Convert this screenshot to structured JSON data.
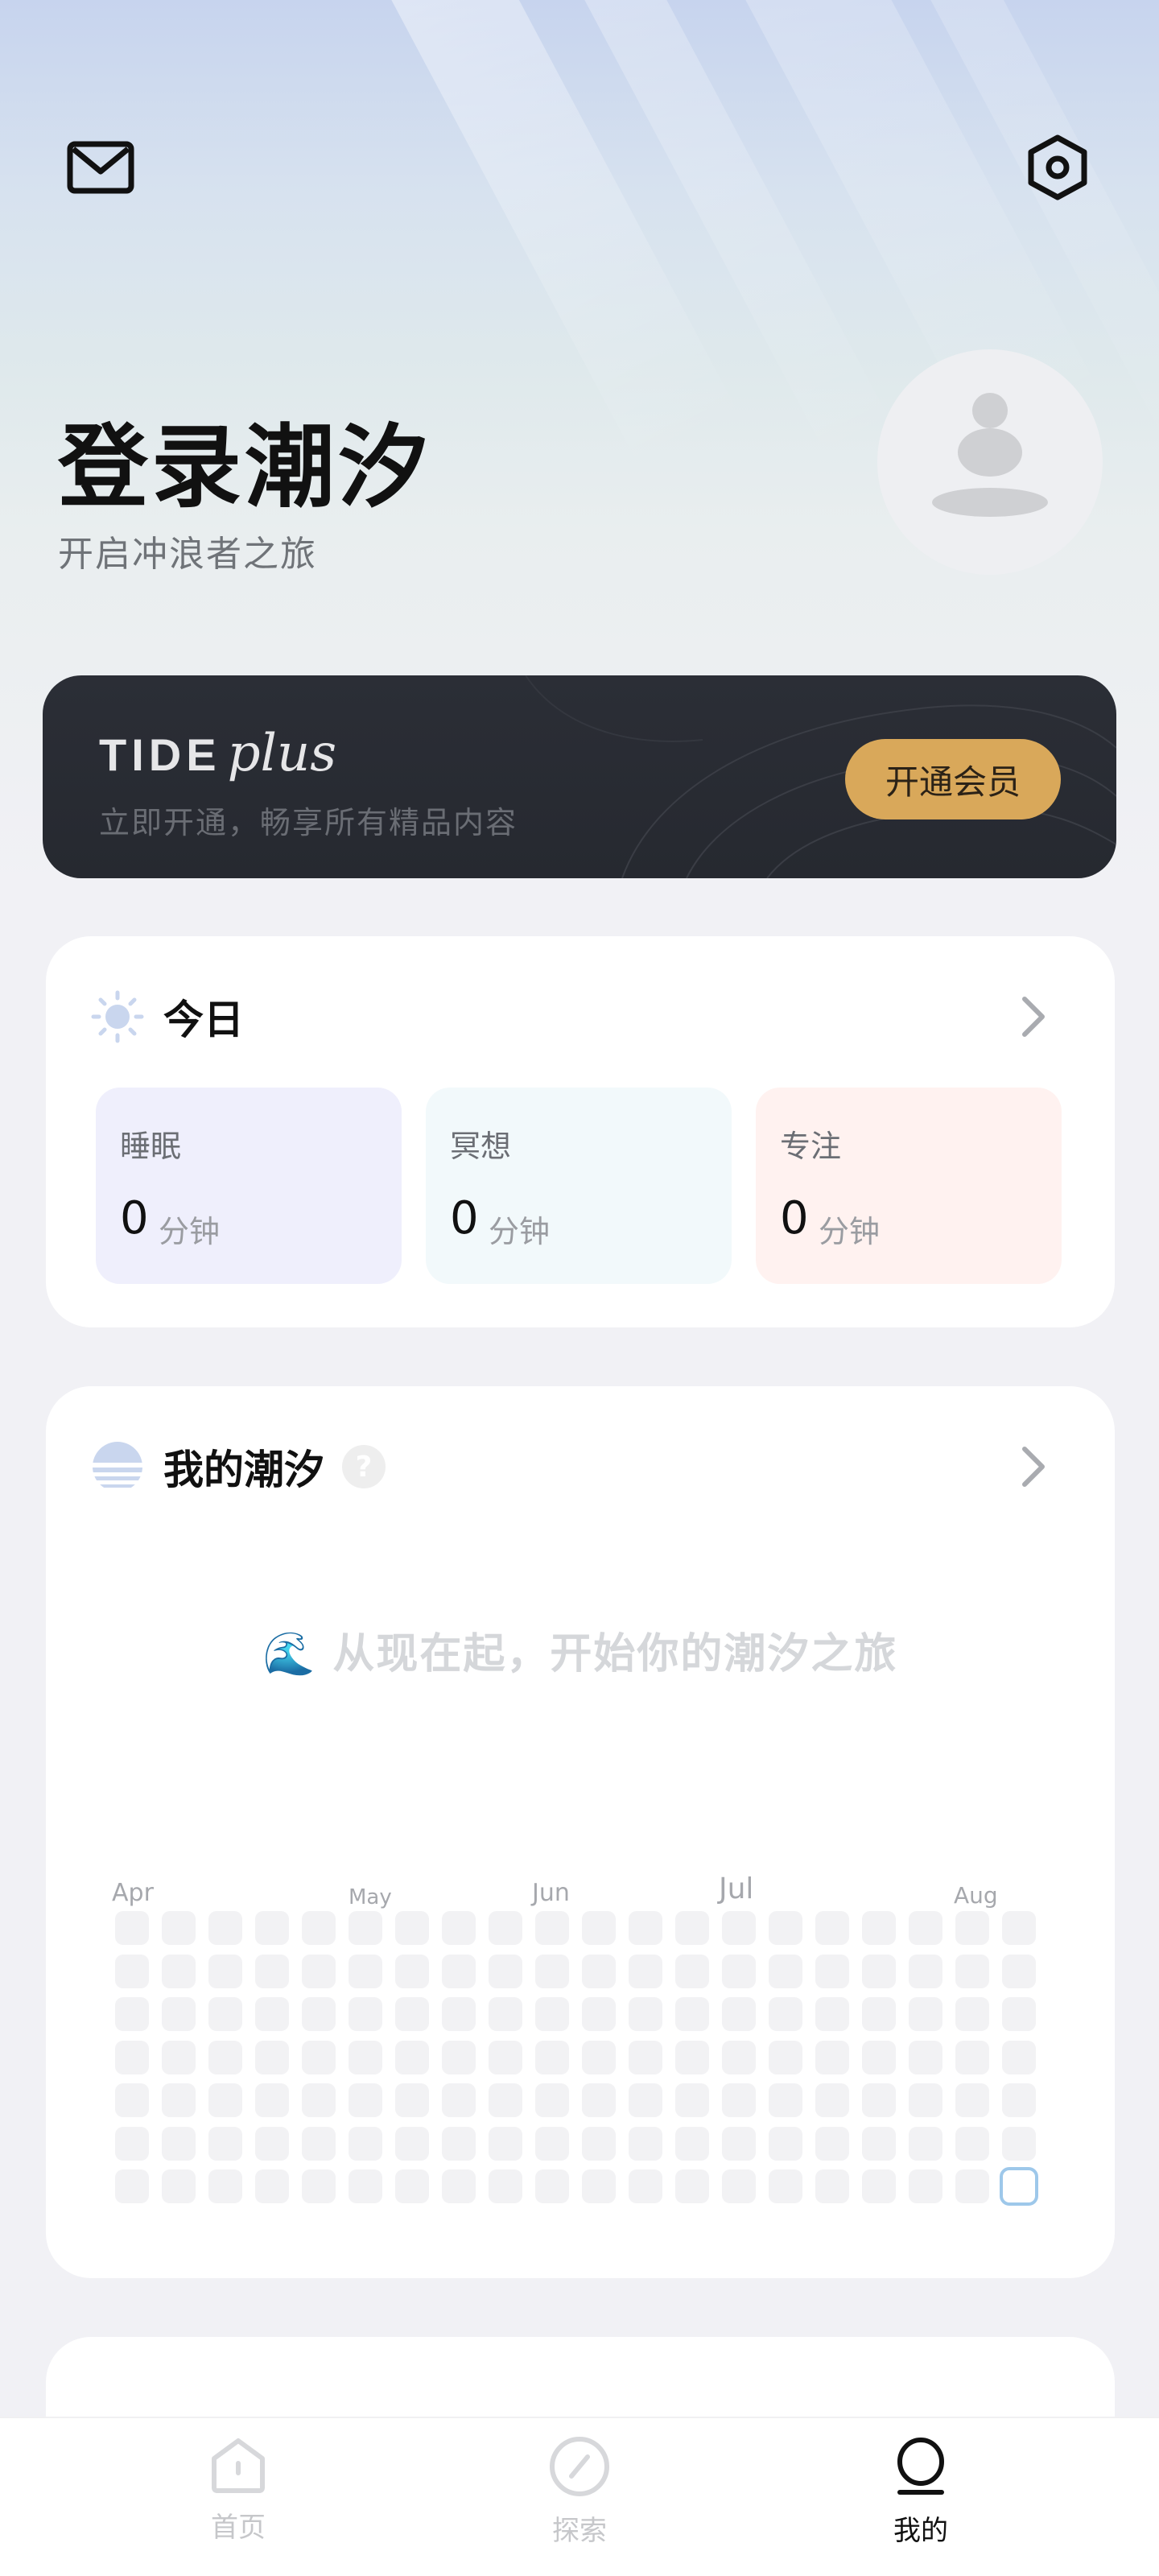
{
  "header": {
    "mail_icon": "mail-icon",
    "settings_icon": "settings-hexagon-icon"
  },
  "profile": {
    "title": "登录潮汐",
    "subtitle": "开启冲浪者之旅",
    "avatar_icon": "meditation-person-icon"
  },
  "vip": {
    "brand_tide": "TIDE",
    "brand_plus": "plus",
    "description": "立即开通，畅享所有精品内容",
    "button": "开通会员",
    "button_color": "#d9a85a"
  },
  "today": {
    "title": "今日",
    "icon": "sun-icon",
    "stats": [
      {
        "label": "睡眠",
        "value": "0",
        "unit": "分钟",
        "color": "#efeffc"
      },
      {
        "label": "冥想",
        "value": "0",
        "unit": "分钟",
        "color": "#f2f9fb"
      },
      {
        "label": "专注",
        "value": "0",
        "unit": "分钟",
        "color": "#fff2f0"
      }
    ]
  },
  "my_tide": {
    "title": "我的潮汐",
    "icon": "horizon-icon",
    "help_icon": "question-icon",
    "help_text": "?",
    "empty_message": "🌊 从现在起，开始你的潮汐之旅",
    "months": [
      "Apr",
      "May",
      "Jun",
      "Jul",
      "Aug"
    ],
    "weeks": 20,
    "days_per_week": 7
  },
  "tabs": [
    {
      "label": "首页",
      "icon": "home-icon",
      "active": false
    },
    {
      "label": "探索",
      "icon": "compass-icon",
      "active": false
    },
    {
      "label": "我的",
      "icon": "profile-icon",
      "active": true
    }
  ]
}
